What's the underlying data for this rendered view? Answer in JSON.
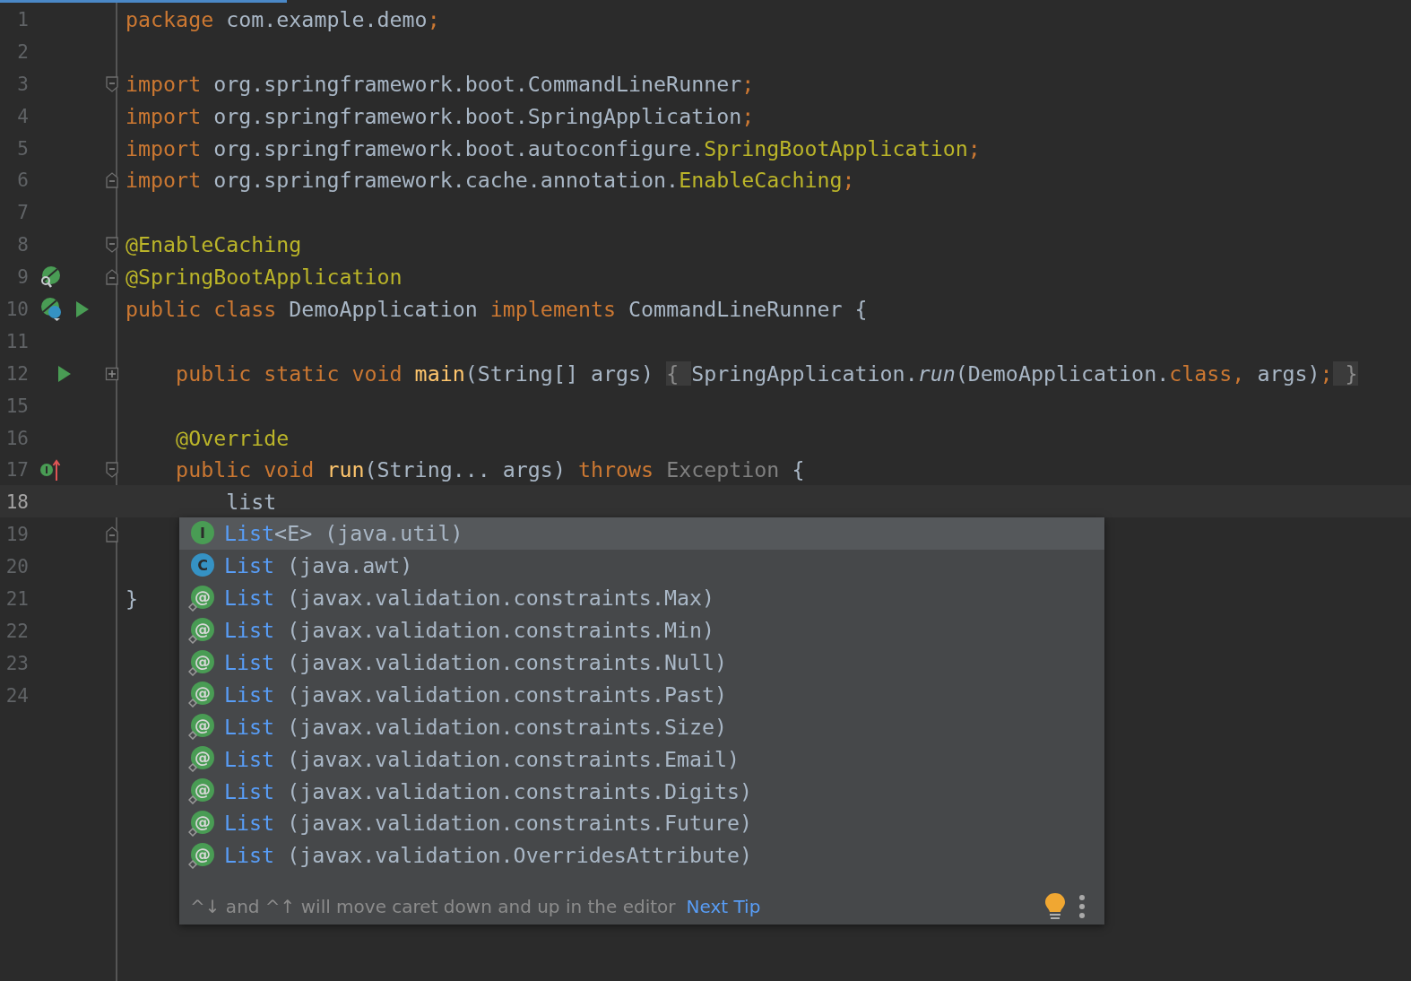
{
  "editor": {
    "lines": [
      {
        "number": "1",
        "current": false,
        "tokens": [
          {
            "kind": "kw",
            "t": "package "
          },
          {
            "kind": "plain",
            "t": "com.example.demo"
          },
          {
            "kind": "kw",
            "t": ";"
          }
        ]
      },
      {
        "number": "2",
        "current": false
      },
      {
        "number": "3",
        "current": false,
        "fold": {
          "kind": "start"
        },
        "tokens": [
          {
            "kind": "kw",
            "t": "import "
          },
          {
            "kind": "plain",
            "t": "org.springframework.boot.CommandLineRunner"
          },
          {
            "kind": "kw",
            "t": ";"
          }
        ]
      },
      {
        "number": "4",
        "current": false,
        "tokens": [
          {
            "kind": "kw",
            "t": "import "
          },
          {
            "kind": "plain",
            "t": "org.springframework.boot.SpringApplication"
          },
          {
            "kind": "kw",
            "t": ";"
          }
        ]
      },
      {
        "number": "5",
        "current": false,
        "tokens": [
          {
            "kind": "kw",
            "t": "import "
          },
          {
            "kind": "plain",
            "t": "org.springframework.boot.autoconfigure."
          },
          {
            "kind": "ann",
            "t": "SpringBootApplication"
          },
          {
            "kind": "kw",
            "t": ";"
          }
        ]
      },
      {
        "number": "6",
        "current": false,
        "fold": {
          "kind": "end"
        },
        "tokens": [
          {
            "kind": "kw",
            "t": "import "
          },
          {
            "kind": "plain",
            "t": "org.springframework.cache.annotation."
          },
          {
            "kind": "ann",
            "t": "EnableCaching"
          },
          {
            "kind": "kw",
            "t": ";"
          }
        ]
      },
      {
        "number": "7",
        "current": false
      },
      {
        "number": "8",
        "current": false,
        "fold": {
          "kind": "start"
        },
        "tokens": [
          {
            "kind": "ann",
            "t": "@EnableCaching"
          }
        ]
      },
      {
        "number": "9",
        "current": false,
        "fold": {
          "kind": "end"
        },
        "marks": [
          {
            "kind": "bean-search"
          }
        ],
        "tokens": [
          {
            "kind": "ann",
            "t": "@SpringBootApplication"
          }
        ]
      },
      {
        "number": "10",
        "current": false,
        "marks": [
          {
            "kind": "bean-class"
          },
          {
            "kind": "run"
          }
        ],
        "tokens": [
          {
            "kind": "kw",
            "t": "public class "
          },
          {
            "kind": "plain",
            "t": "DemoApplication "
          },
          {
            "kind": "kw",
            "t": "implements "
          },
          {
            "kind": "plain",
            "t": "CommandLineRunner {"
          }
        ]
      },
      {
        "number": "11",
        "current": false
      },
      {
        "number": "12",
        "current": false,
        "fold": {
          "kind": "collapsed"
        },
        "marks": [
          {
            "kind": "run-indented"
          }
        ],
        "tokens": [
          {
            "kind": "kw",
            "t": "    public static void "
          },
          {
            "kind": "method",
            "t": "main"
          },
          {
            "kind": "plain",
            "t": "(String[] args) "
          },
          {
            "kind": "folded",
            "t": "{ "
          },
          {
            "kind": "plain",
            "t": "SpringApplication."
          },
          {
            "kind": "italic",
            "t": "run"
          },
          {
            "kind": "plain",
            "t": "(DemoApplication."
          },
          {
            "kind": "kw",
            "t": "class, "
          },
          {
            "kind": "plain",
            "t": "args)"
          },
          {
            "kind": "kw",
            "t": ";"
          },
          {
            "kind": "folded",
            "t": " }"
          }
        ]
      },
      {
        "number": "15",
        "current": false
      },
      {
        "number": "16",
        "current": false,
        "tokens": [
          {
            "kind": "ann",
            "t": "    @Override"
          }
        ]
      },
      {
        "number": "17",
        "current": false,
        "fold": {
          "kind": "start"
        },
        "marks": [
          {
            "kind": "implements"
          }
        ],
        "tokens": [
          {
            "kind": "kw",
            "t": "    public void "
          },
          {
            "kind": "method",
            "t": "run"
          },
          {
            "kind": "plain",
            "t": "(String... args) "
          },
          {
            "kind": "kw",
            "t": "throws "
          },
          {
            "kind": "gray",
            "t": "Exception "
          },
          {
            "kind": "plain",
            "t": "{"
          }
        ]
      },
      {
        "number": "18",
        "current": true,
        "tokens": [
          {
            "kind": "plain",
            "t": "        list"
          }
        ]
      },
      {
        "number": "19",
        "current": false,
        "fold": {
          "kind": "end"
        }
      },
      {
        "number": "20",
        "current": false
      },
      {
        "number": "21",
        "current": false,
        "tokens": [
          {
            "kind": "plain",
            "t": "}"
          }
        ]
      },
      {
        "number": "22",
        "current": false
      },
      {
        "number": "23",
        "current": false
      },
      {
        "number": "24",
        "current": false
      }
    ]
  },
  "completion": {
    "items": [
      {
        "kind": "interface",
        "icon_letter": "I",
        "name": "List",
        "generic": "<E>",
        "package": " (java.util)",
        "selected": true
      },
      {
        "kind": "class",
        "icon_letter": "C",
        "name": "List",
        "package": " (java.awt)",
        "selected": false
      },
      {
        "kind": "annotation",
        "icon_letter": "@",
        "name": "List",
        "package": " (javax.validation.constraints.Max)",
        "selected": false
      },
      {
        "kind": "annotation",
        "icon_letter": "@",
        "name": "List",
        "package": " (javax.validation.constraints.Min)",
        "selected": false
      },
      {
        "kind": "annotation",
        "icon_letter": "@",
        "name": "List",
        "package": " (javax.validation.constraints.Null)",
        "selected": false
      },
      {
        "kind": "annotation",
        "icon_letter": "@",
        "name": "List",
        "package": " (javax.validation.constraints.Past)",
        "selected": false
      },
      {
        "kind": "annotation",
        "icon_letter": "@",
        "name": "List",
        "package": " (javax.validation.constraints.Size)",
        "selected": false
      },
      {
        "kind": "annotation",
        "icon_letter": "@",
        "name": "List",
        "package": " (javax.validation.constraints.Email)",
        "selected": false
      },
      {
        "kind": "annotation",
        "icon_letter": "@",
        "name": "List",
        "package": " (javax.validation.constraints.Digits)",
        "selected": false
      },
      {
        "kind": "annotation",
        "icon_letter": "@",
        "name": "List",
        "package": " (javax.validation.constraints.Future)",
        "selected": false
      },
      {
        "kind": "annotation",
        "icon_letter": "@",
        "name": "List",
        "package": " (javax.validation.OverridesAttribute)",
        "selected": false
      }
    ],
    "tip": "^↓ and ^↑ will move caret down and up in the editor",
    "tip_link": "Next Tip"
  }
}
